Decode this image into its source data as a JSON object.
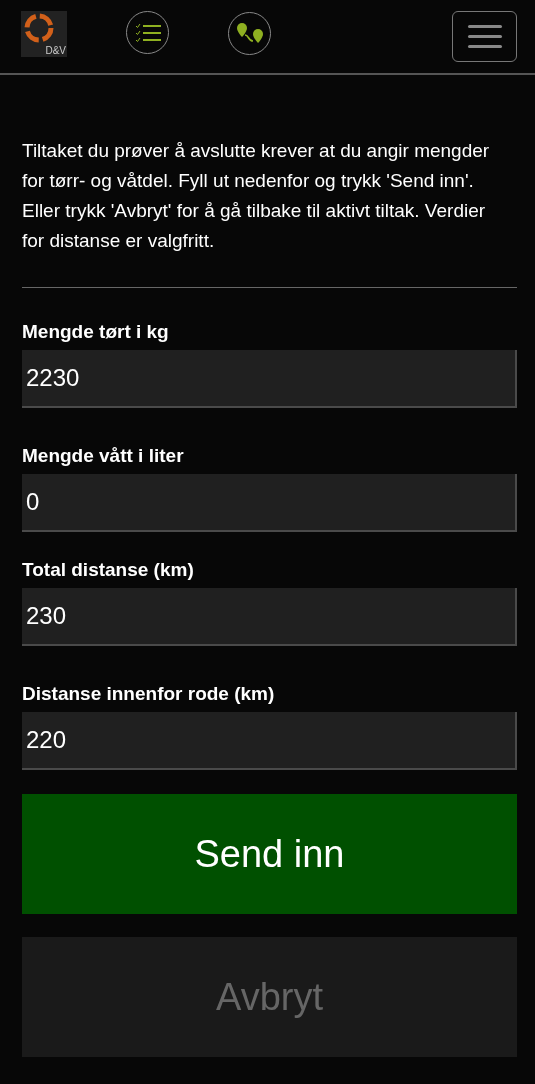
{
  "header": {
    "logo_text": "D&V"
  },
  "intro": "Tiltaket du prøver å avslutte krever at du angir mengder for tørr- og våtdel. Fyll ut nedenfor og trykk 'Send inn'. Eller trykk 'Avbryt' for å gå tilbake til aktivt tiltak. Verdier for distanse er valgfritt.",
  "fields": [
    {
      "label": "Mengde tørt i kg",
      "value": "2230"
    },
    {
      "label": "Mengde vått i liter",
      "value": "0"
    },
    {
      "label": "Total distanse (km)",
      "value": "230"
    },
    {
      "label": "Distanse innenfor rode (km)",
      "value": "220"
    }
  ],
  "buttons": [
    {
      "label": "Send inn",
      "disabled": false
    },
    {
      "label": "Avbryt",
      "disabled": true
    }
  ]
}
